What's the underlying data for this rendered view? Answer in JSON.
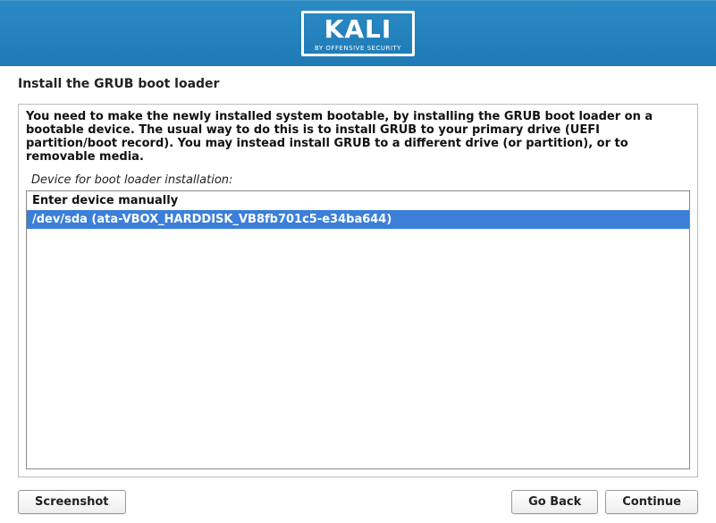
{
  "header": {
    "logo_text": "KALI",
    "logo_subtext": "BY OFFENSIVE SECURITY"
  },
  "title": "Install the GRUB boot loader",
  "main": {
    "instruction": "You need to make the newly installed system bootable, by installing the GRUB boot loader on a bootable device. The usual way to do this is to install GRUB to your primary drive (UEFI partition/boot record). You may instead install GRUB to a different drive (or partition), or to removable media.",
    "field_label": "Device for boot loader installation:",
    "devices": [
      {
        "label": "Enter device manually",
        "selected": false
      },
      {
        "label": "/dev/sda  (ata-VBOX_HARDDISK_VB8fb701c5-e34ba644)",
        "selected": true
      }
    ]
  },
  "footer": {
    "screenshot_label": "Screenshot",
    "goback_label": "Go Back",
    "continue_label": "Continue"
  }
}
